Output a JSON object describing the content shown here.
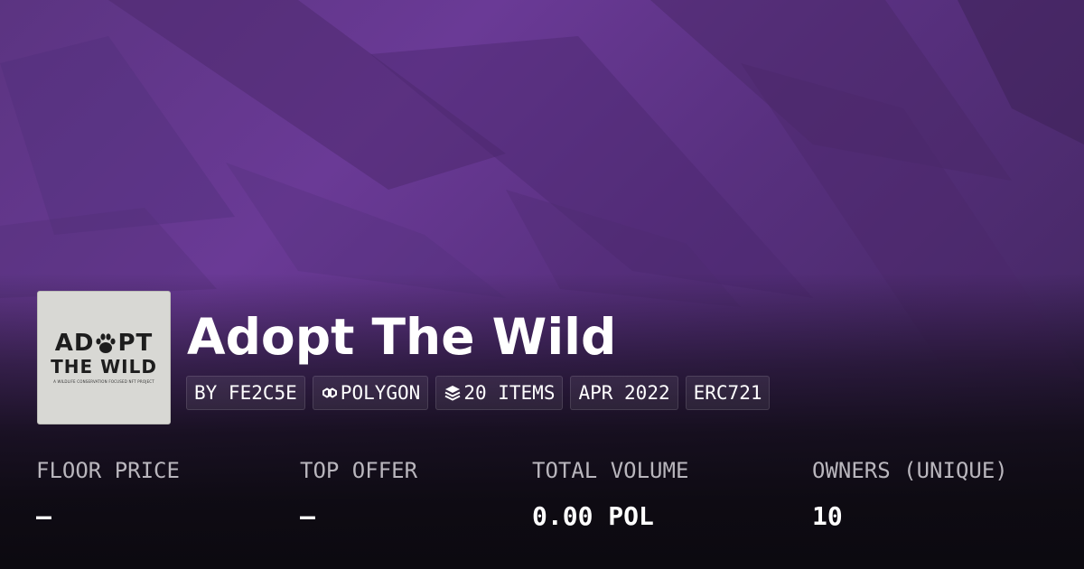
{
  "collection": {
    "name": "Adopt The Wild",
    "logo": {
      "text_line1_start": "AD",
      "text_line1_end": "PT",
      "text_line2": "THE WILD",
      "tagline": "A WILDLIFE CONSERVATION FOCUSED NFT PROJECT",
      "paw_icon": "paw-icon"
    }
  },
  "pills": {
    "creator": "BY FE2C5E",
    "chain": "POLYGON",
    "chain_icon": "polygon-chain-icon",
    "items": "20 ITEMS",
    "items_icon": "layers-icon",
    "date": "APR 2022",
    "standard": "ERC721"
  },
  "stats": {
    "floor_price": {
      "label": "FLOOR PRICE",
      "value": "–"
    },
    "top_offer": {
      "label": "TOP OFFER",
      "value": "–"
    },
    "total_volume": {
      "label": "TOTAL VOLUME",
      "value": "0.00 POL"
    },
    "owners": {
      "label": "OWNERS (UNIQUE)",
      "value": "10"
    }
  },
  "colors": {
    "banner_purple": "#6a3a96",
    "background": "#0c0a10",
    "label_gray": "#b9b6bd",
    "text_white": "#ffffff"
  }
}
